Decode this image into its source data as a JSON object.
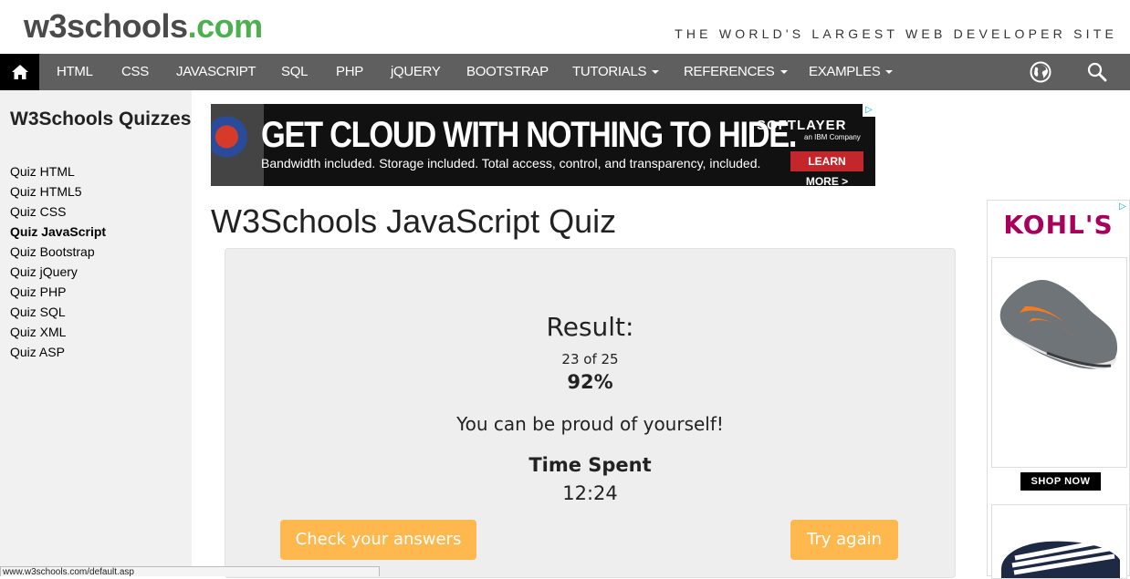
{
  "header": {
    "logo_main": "w3schools",
    "logo_dot": ".com",
    "tagline": "THE WORLD'S LARGEST WEB DEVELOPER SITE"
  },
  "nav": {
    "items": [
      {
        "label": "HTML",
        "dropdown": false
      },
      {
        "label": "CSS",
        "dropdown": false
      },
      {
        "label": "JAVASCRIPT",
        "dropdown": false
      },
      {
        "label": "SQL",
        "dropdown": false
      },
      {
        "label": "PHP",
        "dropdown": false
      },
      {
        "label": "jQUERY",
        "dropdown": false
      },
      {
        "label": "BOOTSTRAP",
        "dropdown": false
      },
      {
        "label": "TUTORIALS",
        "dropdown": true
      },
      {
        "label": "REFERENCES",
        "dropdown": true
      },
      {
        "label": "EXAMPLES",
        "dropdown": true
      }
    ],
    "icons": [
      "home-icon",
      "globe-icon",
      "search-icon"
    ]
  },
  "sidebar": {
    "heading": "W3Schools Quizzes",
    "links": [
      {
        "label": "Quiz HTML",
        "active": false
      },
      {
        "label": "Quiz HTML5",
        "active": false
      },
      {
        "label": "Quiz CSS",
        "active": false
      },
      {
        "label": "Quiz JavaScript",
        "active": true
      },
      {
        "label": "Quiz Bootstrap",
        "active": false
      },
      {
        "label": "Quiz jQuery",
        "active": false
      },
      {
        "label": "Quiz PHP",
        "active": false
      },
      {
        "label": "Quiz SQL",
        "active": false
      },
      {
        "label": "Quiz XML",
        "active": false
      },
      {
        "label": "Quiz ASP",
        "active": false
      }
    ]
  },
  "banner_ad": {
    "headline": "GET CLOUD WITH NOTHING TO HIDE.",
    "subtext": "Bandwidth included. Storage included. Total access, control, and transparency, included.",
    "brand": "SOFTLAYER",
    "brand_sub": "an IBM Company",
    "cta": "LEARN MORE >"
  },
  "main": {
    "title": "W3Schools JavaScript Quiz",
    "result": {
      "heading": "Result:",
      "score_text": "23 of 25",
      "percent": "92%",
      "message": "You can be proud of yourself!",
      "time_label": "Time Spent",
      "time_value": "12:24"
    },
    "buttons": {
      "check": "Check your answers",
      "again": "Try again"
    }
  },
  "side_ad": {
    "brand": "KOHL'S",
    "cta": "SHOP NOW"
  },
  "status_bar": {
    "url": "www.w3schools.com/default.asp"
  },
  "colors": {
    "nav_bg": "#5f5f5f",
    "accent_green": "#4CAF50",
    "button_orange": "#ffb84d",
    "panel_bg": "#eeeeee",
    "sidebar_bg": "#f1f1f1"
  }
}
